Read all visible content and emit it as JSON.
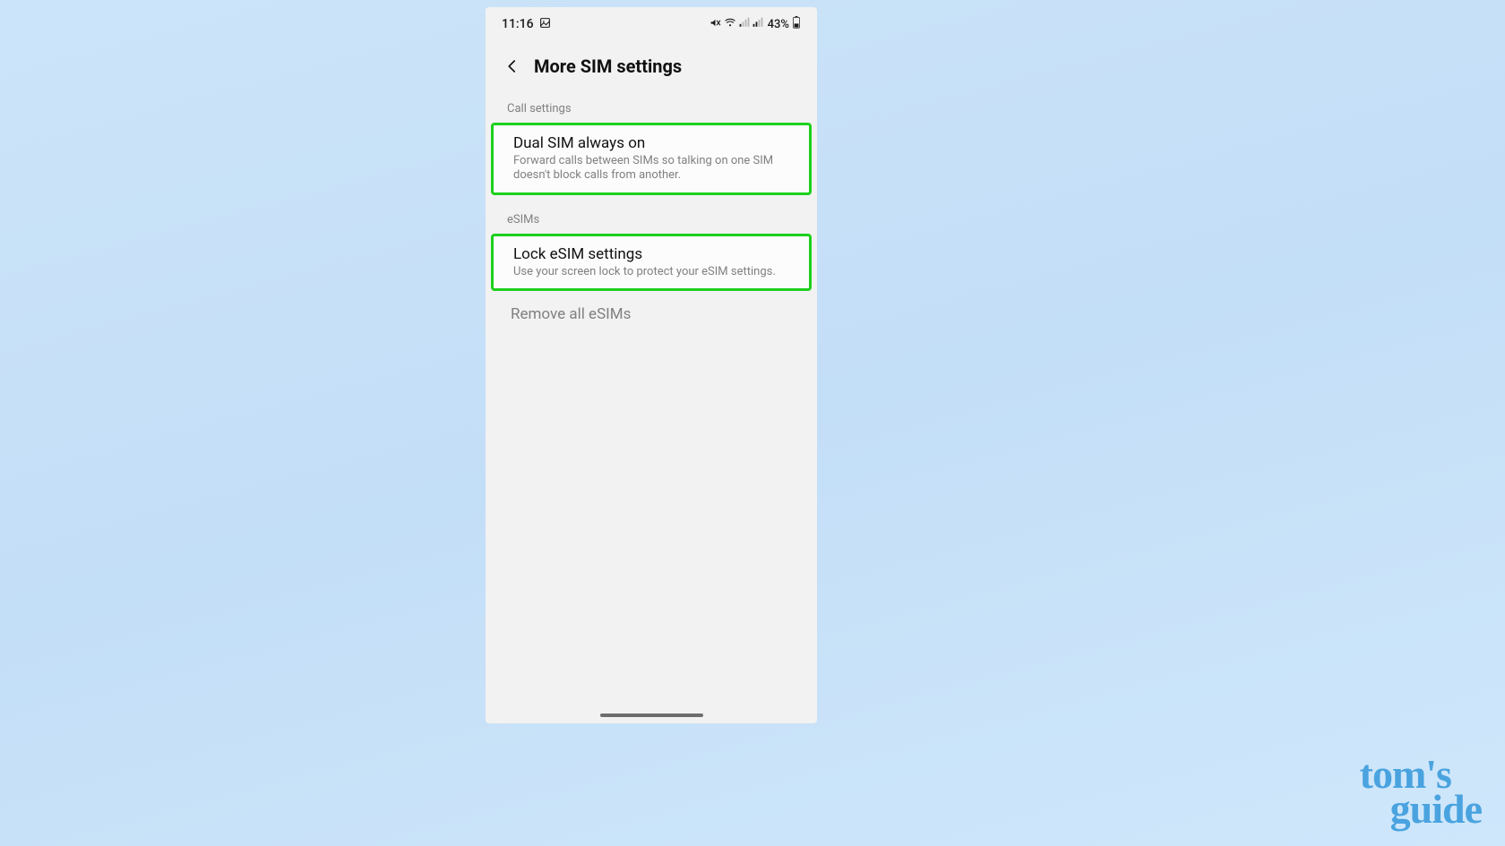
{
  "statusbar": {
    "time": "11:16",
    "battery_pct": "43%"
  },
  "header": {
    "title": "More SIM settings"
  },
  "sections": {
    "call": {
      "label": "Call settings",
      "item": {
        "title": "Dual SIM always on",
        "desc": "Forward calls between SIMs so talking on one SIM doesn't block calls from another."
      }
    },
    "esims": {
      "label": "eSIMs",
      "lock": {
        "title": "Lock eSIM settings",
        "desc": "Use your screen lock to protect your eSIM settings."
      },
      "remove": {
        "title": "Remove all eSIMs"
      }
    }
  },
  "watermark": {
    "line1": "tom's",
    "line2": "guide"
  }
}
